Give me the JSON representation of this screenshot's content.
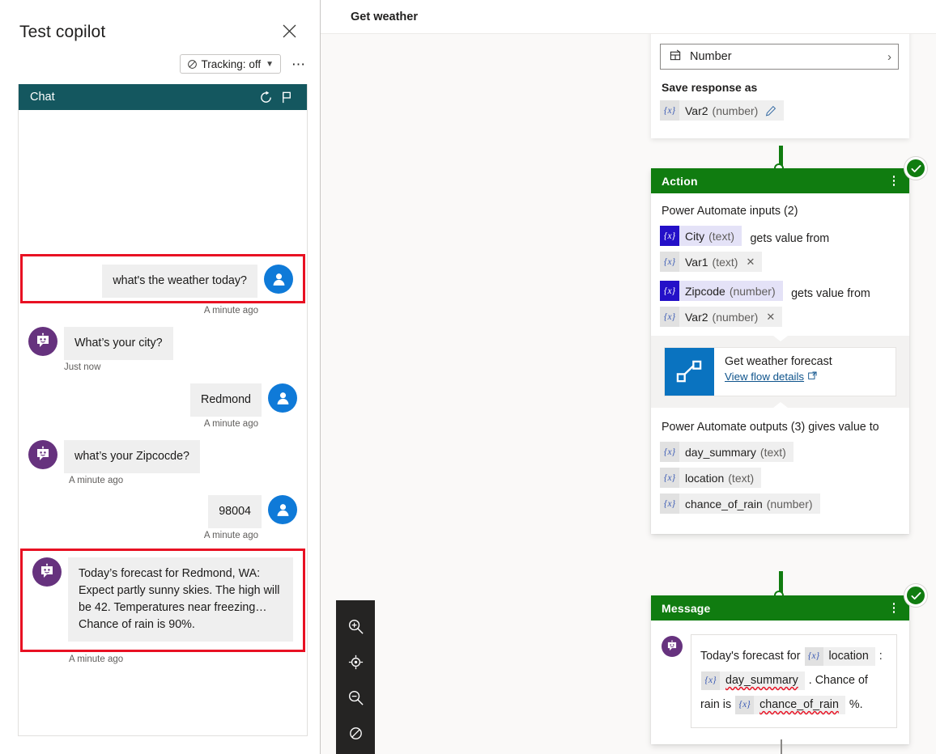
{
  "test_panel": {
    "title": "Test copilot",
    "close_label": "Close",
    "tracking_label": "Tracking: off",
    "more_label": "⋯",
    "chat": {
      "header_title": "Chat",
      "restart_icon": "restart-icon",
      "flag_icon": "flag-icon",
      "messages": [
        {
          "author": "user",
          "text": "what's the weather today?",
          "timestamp": "A minute ago",
          "highlighted": true
        },
        {
          "author": "bot",
          "text": "What’s your city?",
          "timestamp": "Just now",
          "highlighted": false
        },
        {
          "author": "user",
          "text": "Redmond",
          "timestamp": "A minute ago",
          "highlighted": false
        },
        {
          "author": "bot",
          "text": "what’s your Zipcocde?",
          "timestamp": "A minute ago",
          "highlighted": false
        },
        {
          "author": "user",
          "text": "98004",
          "timestamp": "A minute ago",
          "highlighted": false
        },
        {
          "author": "bot",
          "text": "Today’s forecast for Redmond, WA: Expect partly sunny skies. The high will be 42. Temperatures near freezing… Chance of rain is 90%.",
          "timestamp": "A minute ago",
          "highlighted": true
        }
      ]
    }
  },
  "canvas": {
    "topic_title": "Get weather",
    "question_node": {
      "identify_value": "Number",
      "identify_icon": "entity-icon",
      "save_response_label": "Save response as",
      "variable": {
        "name": "Var2",
        "type": "(number)",
        "edit_icon": "pencil-icon"
      }
    },
    "action_node": {
      "header": "Action",
      "status_icon": "check-circle-icon",
      "menu_icon": "more-vertical-icon",
      "inputs_label": "Power Automate inputs (2)",
      "inputs": [
        {
          "param": {
            "name": "City",
            "type": "(text)"
          },
          "connector_text": "gets value from",
          "value": {
            "name": "Var1",
            "type": "(text)",
            "remove_icon": "close-icon"
          }
        },
        {
          "param": {
            "name": "Zipcode",
            "type": "(number)"
          },
          "connector_text": "gets value from",
          "value": {
            "name": "Var2",
            "type": "(number)",
            "remove_icon": "close-icon"
          }
        }
      ],
      "flow_card": {
        "icon": "power-automate-icon",
        "title": "Get weather forecast",
        "link_label": "View flow details",
        "link_icon": "open-in-new-icon"
      },
      "outputs_label": "Power Automate outputs (3) gives value to",
      "outputs": [
        {
          "name": "day_summary",
          "type": "(text)"
        },
        {
          "name": "location",
          "type": "(text)"
        },
        {
          "name": "chance_of_rain",
          "type": "(number)"
        }
      ]
    },
    "message_node": {
      "header": "Message",
      "status_icon": "check-circle-icon",
      "menu_icon": "more-vertical-icon",
      "avatar_icon": "bot-avatar-icon",
      "text_part1": "Today's forecast for",
      "token1": "location",
      "text_part2": ":",
      "token2": "day_summary",
      "text_part3": ". Chance of rain is",
      "token3": "chance_of_rain",
      "text_part4": "%."
    },
    "zoom_toolbar": {
      "buttons": [
        {
          "icon": "zoom-in-icon",
          "label": "Zoom in"
        },
        {
          "icon": "fit-to-screen-icon",
          "label": "Fit to screen"
        },
        {
          "icon": "zoom-out-icon",
          "label": "Zoom out"
        },
        {
          "icon": "reset-view-icon",
          "label": "Reset view"
        }
      ]
    }
  },
  "colors": {
    "chat_header": "#14575f",
    "node_green": "#107c10",
    "user_avatar": "#0f7ad8",
    "bot_avatar": "#66327e",
    "highlight_red": "#e81123",
    "flow_blue": "#0a73c0",
    "param_chip": "#2410c8"
  }
}
